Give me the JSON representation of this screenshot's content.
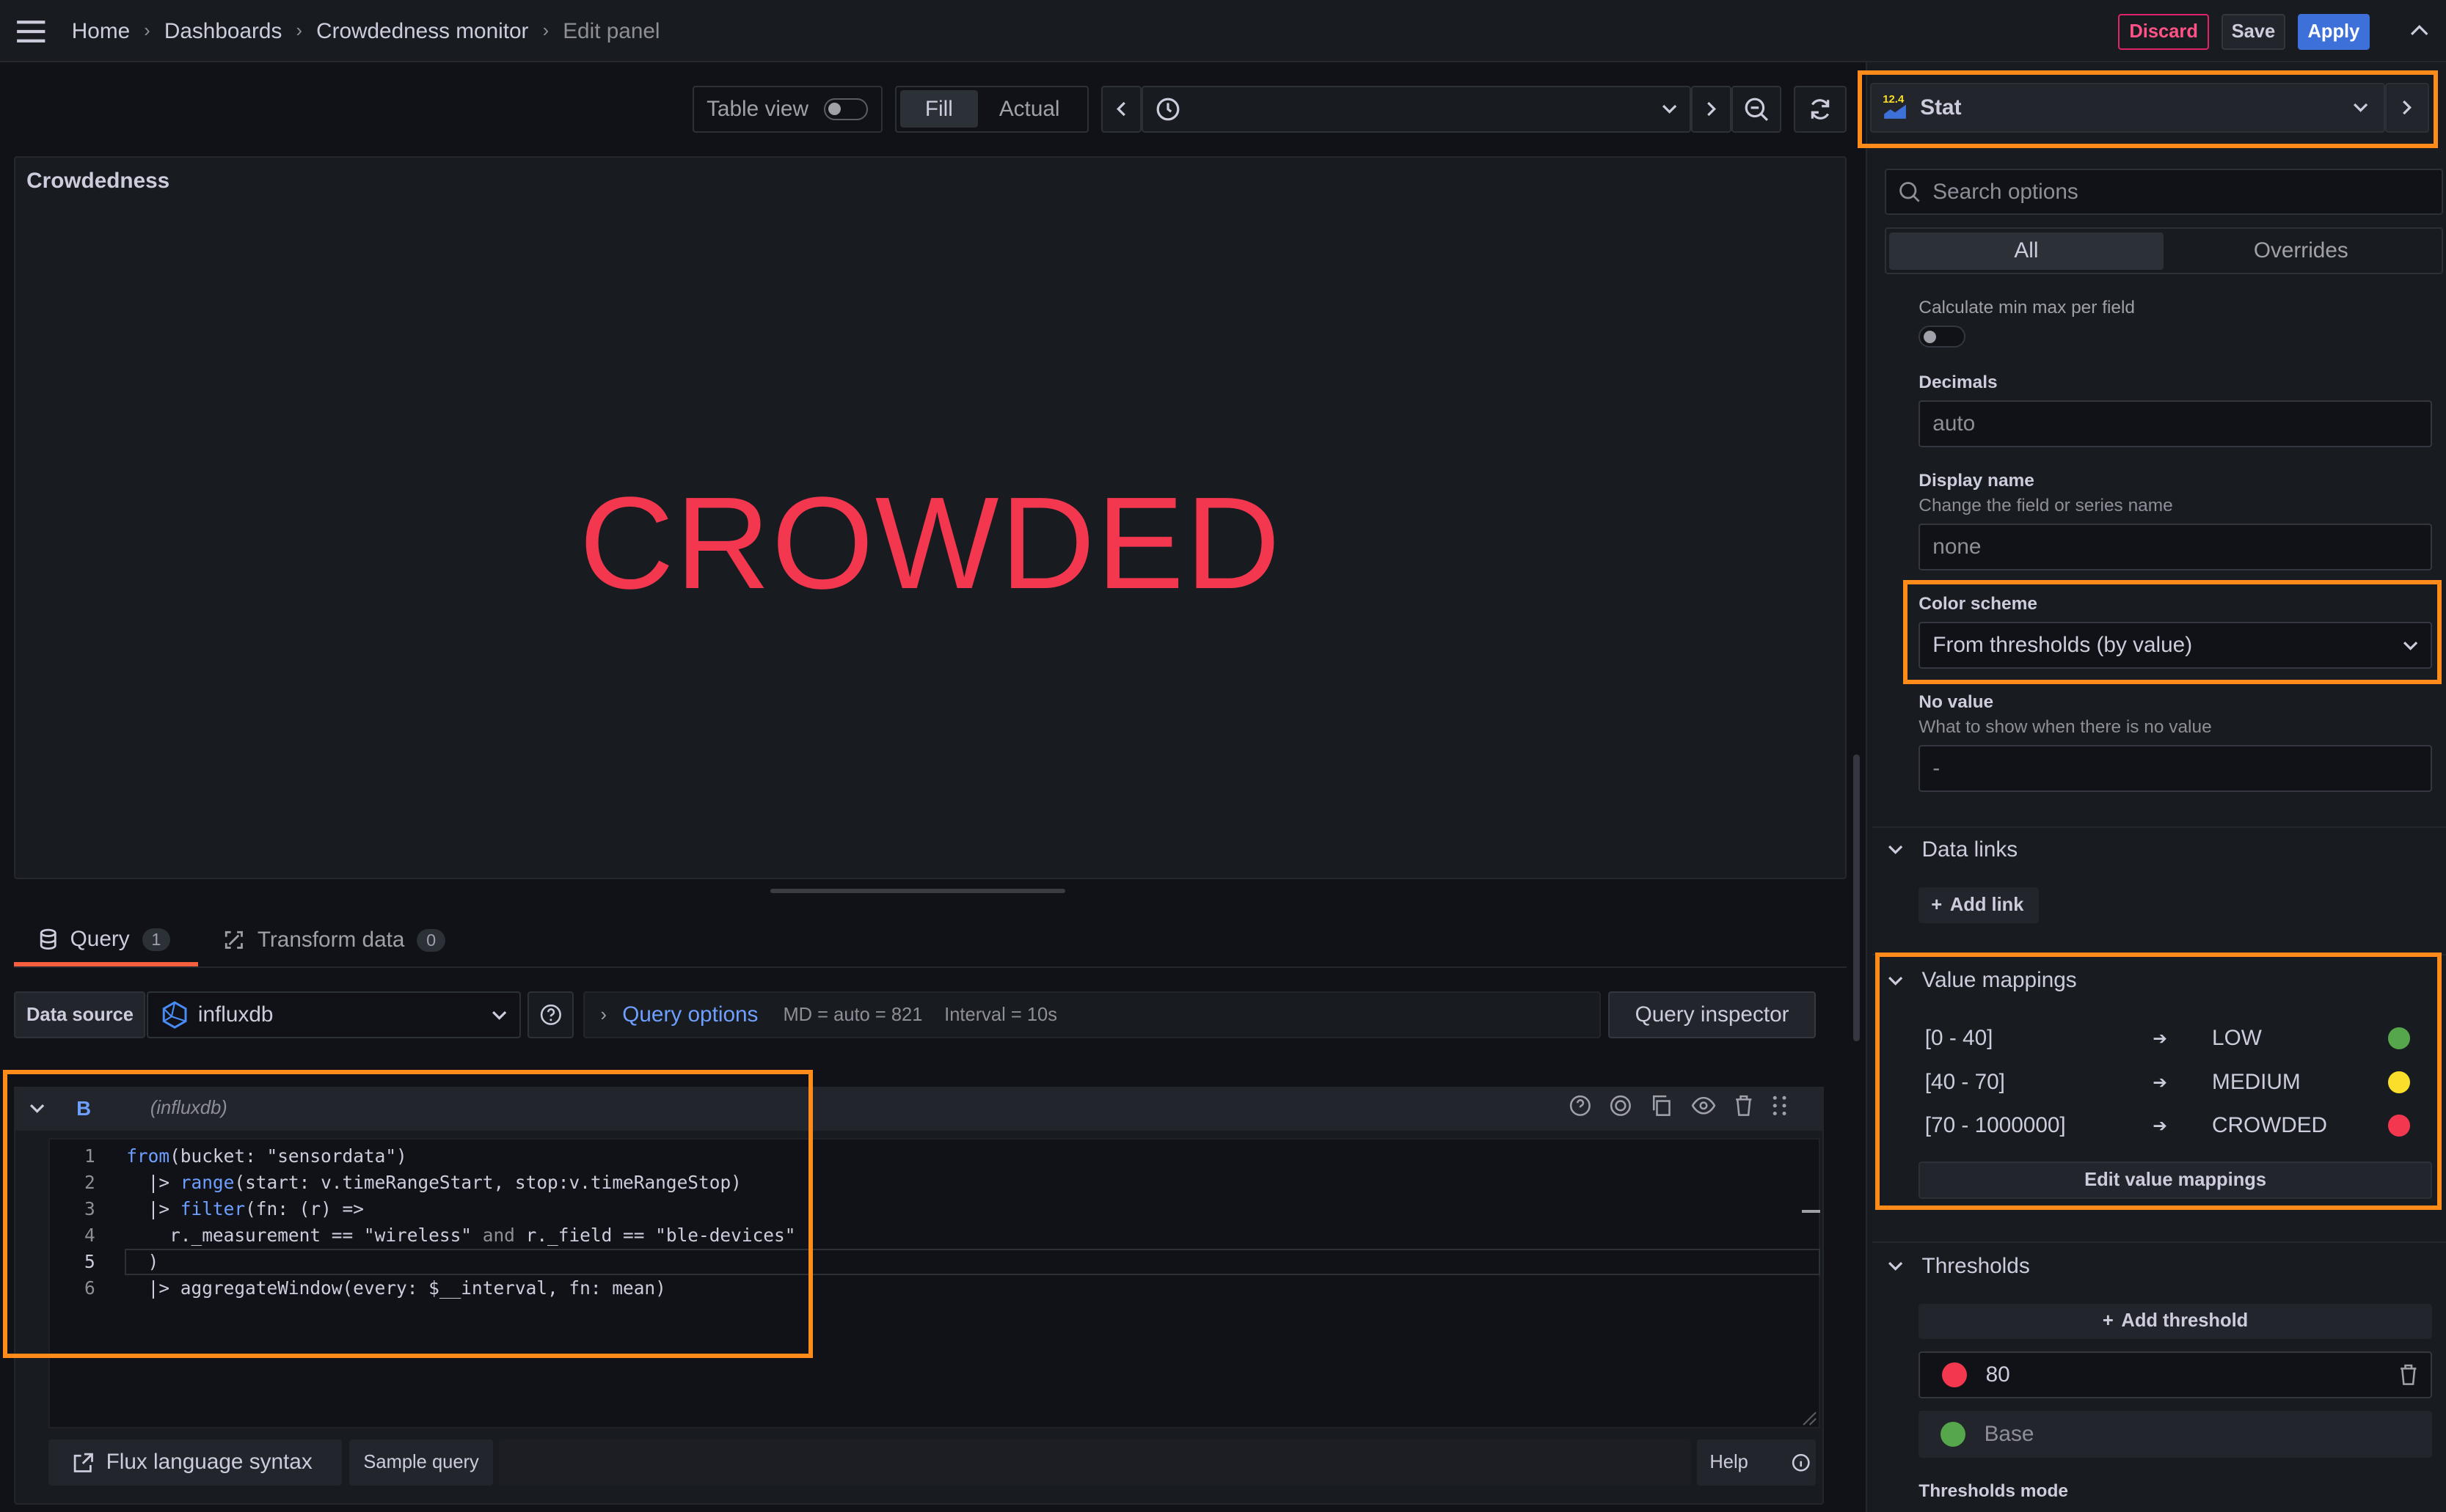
{
  "nav": {
    "crumbs": [
      "Home",
      "Dashboards",
      "Crowdedness monitor",
      "Edit panel"
    ],
    "discard": "Discard",
    "save": "Save",
    "apply": "Apply"
  },
  "toolbar": {
    "table_view": "Table view",
    "fill": "Fill",
    "actual": "Actual"
  },
  "panel": {
    "title": "Crowdedness",
    "value": "CROWDED",
    "value_color": "#f2374f"
  },
  "tabs": {
    "query": "Query",
    "query_count": "1",
    "transform": "Transform data",
    "transform_count": "0"
  },
  "datasource": {
    "label": "Data source",
    "name": "influxdb",
    "query_options": "Query options",
    "md": "MD = auto = 821",
    "interval": "Interval = 10s",
    "inspector": "Query inspector"
  },
  "query": {
    "ref": "B",
    "ds": "(influxdb)",
    "lines": [
      {
        "n": "1",
        "pre": "",
        "kw": "from",
        "rest": "(bucket: \"sensordata\")"
      },
      {
        "n": "2",
        "pre": "  |> ",
        "kw": "range",
        "rest": "(start: v.timeRangeStart, stop:v.timeRangeStop)"
      },
      {
        "n": "3",
        "pre": "  |> ",
        "kw": "filter",
        "rest": "(fn: (r) =>"
      },
      {
        "n": "4",
        "pre": "    r._measurement == \"wireless\" ",
        "kw": "and",
        "rest": " r._field == \"ble-devices\""
      },
      {
        "n": "5",
        "pre": "  )",
        "kw": "",
        "rest": ""
      },
      {
        "n": "6",
        "pre": "  |> aggregateWindow(every: $__interval, fn: mean)",
        "kw": "",
        "rest": ""
      }
    ],
    "flux_link": "Flux language syntax",
    "sample": "Sample query",
    "help": "Help"
  },
  "options": {
    "viz": "Stat",
    "viz_badge": "12.4",
    "search_placeholder": "Search options",
    "tab_all": "All",
    "tab_overrides": "Overrides",
    "calc_minmax": "Calculate min max per field",
    "decimals_label": "Decimals",
    "decimals_placeholder": "auto",
    "display_name_label": "Display name",
    "display_name_desc": "Change the field or series name",
    "display_name_placeholder": "none",
    "color_scheme_label": "Color scheme",
    "color_scheme_value": "From thresholds (by value)",
    "no_value_label": "No value",
    "no_value_desc": "What to show when there is no value",
    "no_value_placeholder": "-",
    "data_links": "Data links",
    "add_link": "Add link",
    "value_mappings": "Value mappings",
    "mappings": [
      {
        "range": "[0 - 40]",
        "text": "LOW",
        "color": "#56a64b"
      },
      {
        "range": "[40 - 70]",
        "text": "MEDIUM",
        "color": "#fade2a"
      },
      {
        "range": "[70 - 1000000]",
        "text": "CROWDED",
        "color": "#f2374f"
      }
    ],
    "edit_mappings": "Edit value mappings",
    "thresholds": "Thresholds",
    "add_threshold": "Add threshold",
    "threshold_items": [
      {
        "value": "80",
        "color": "#f2374f"
      },
      {
        "value": "Base",
        "color": "#56a64b"
      }
    ],
    "thresholds_mode": "Thresholds mode"
  }
}
